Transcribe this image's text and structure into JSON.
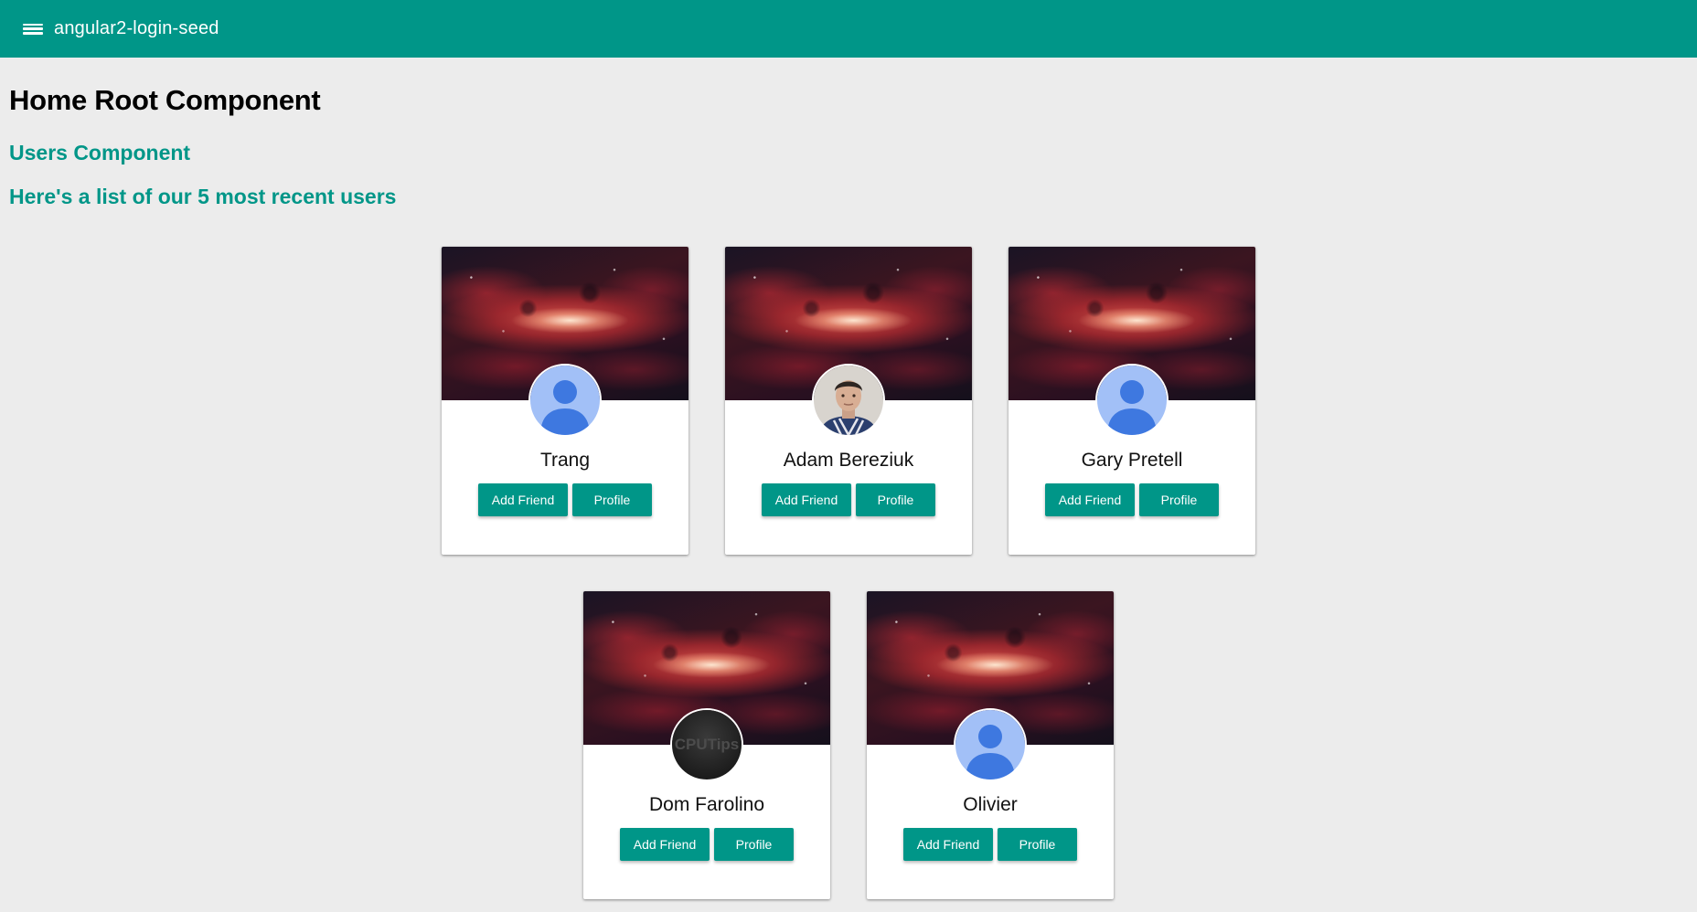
{
  "toolbar": {
    "title": "angular2-login-seed",
    "menu_icon": "menu-icon",
    "background": "#009688"
  },
  "main": {
    "heading": "Home Root Component",
    "users_heading": "Users Component",
    "list_heading": "Here's a list of our 5 most recent users"
  },
  "colors": {
    "accent": "#009688",
    "page_bg": "#ececec"
  },
  "users": [
    {
      "name": "Trang",
      "avatar": "default-avatar-icon",
      "add_label": "Add Friend",
      "profile_label": "Profile"
    },
    {
      "name": "Adam Bereziuk",
      "avatar": "photo-avatar",
      "add_label": "Add Friend",
      "profile_label": "Profile"
    },
    {
      "name": "Gary Pretell",
      "avatar": "default-avatar-icon",
      "add_label": "Add Friend",
      "profile_label": "Profile"
    },
    {
      "name": "Dom Farolino",
      "avatar": "cputips-logo-avatar",
      "avatar_text": "CPUTips",
      "add_label": "Add Friend",
      "profile_label": "Profile"
    },
    {
      "name": "Olivier",
      "avatar": "default-avatar-icon",
      "add_label": "Add Friend",
      "profile_label": "Profile"
    }
  ]
}
